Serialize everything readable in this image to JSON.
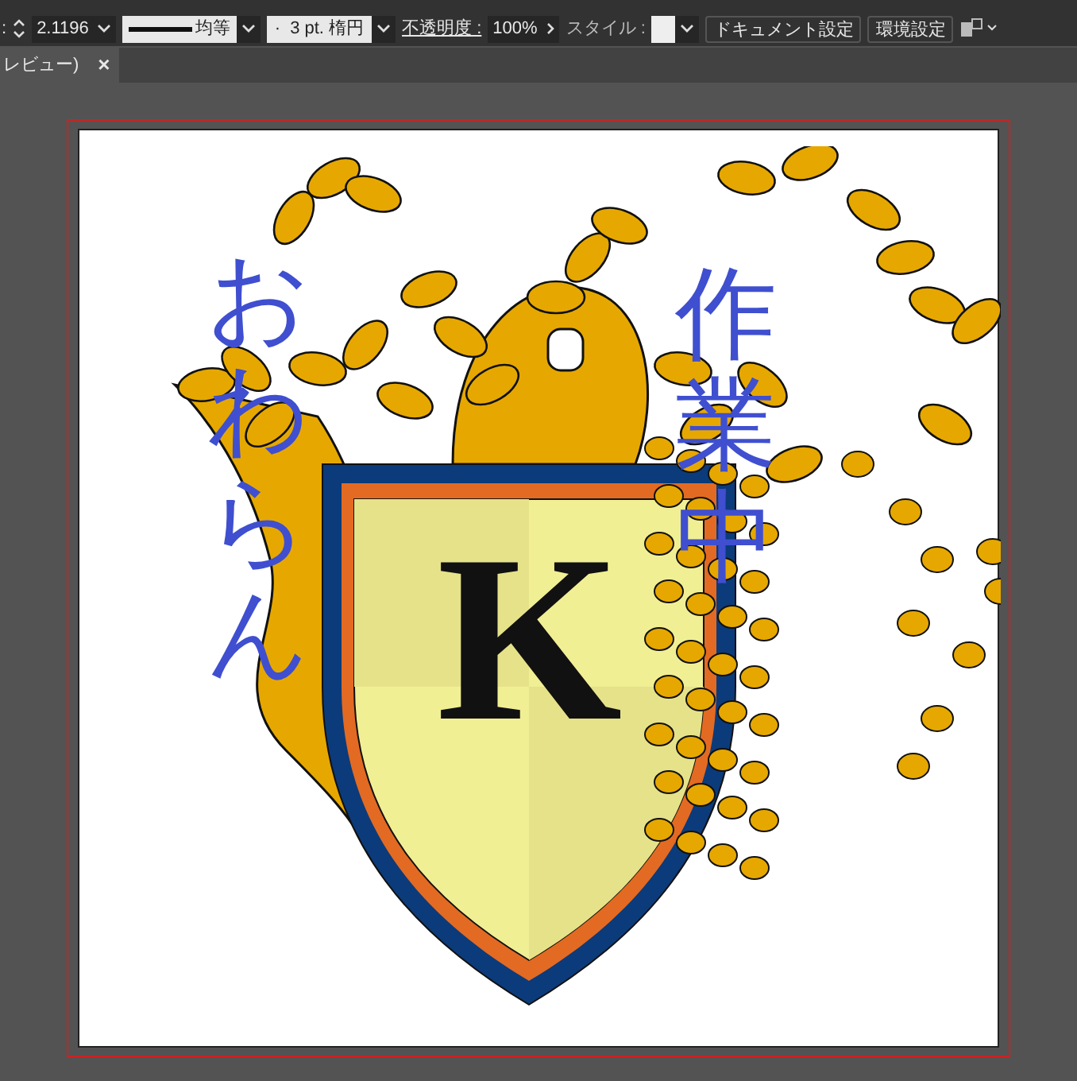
{
  "control_bar": {
    "stroke_label": ":",
    "stroke_weight": "2.1196",
    "stroke_profile": "均等",
    "brush_dot": "·",
    "brush": "3 pt. 楕円",
    "opacity_label": "不透明度 :",
    "opacity": "100%",
    "style_label": "スタイル :",
    "buttons": [
      "ドキュメント設定",
      "環境設定"
    ]
  },
  "tab": {
    "label": "レビュー)",
    "close": "×"
  },
  "artwork": {
    "crest_letter": "K",
    "annotations": [
      "おわらん",
      "作業中"
    ]
  }
}
